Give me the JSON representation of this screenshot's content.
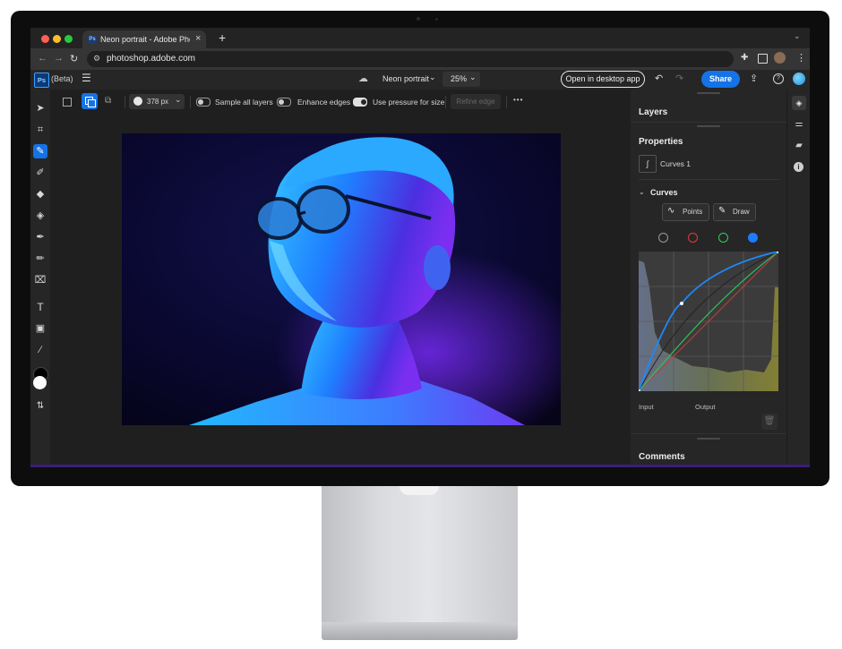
{
  "browser": {
    "tab_title": "Neon portrait - Adobe Photosh",
    "tab_close": "×",
    "new_tab": "+",
    "url": "photoshop.adobe.com",
    "tab_icon_text": "Ps"
  },
  "app": {
    "logo": "Ps",
    "beta_label": "(Beta)",
    "document_name": "Neon portrait",
    "zoom": "25%",
    "open_desktop_label": "Open in desktop app",
    "share_label": "Share"
  },
  "options_bar": {
    "brush_size": "378 px",
    "sample_all_layers": "Sample all layers",
    "enhance_edges": "Enhance edges",
    "use_pressure": "Use pressure for size",
    "refine_edge": "Refine edge",
    "more": "•••",
    "sample_all_layers_on": false,
    "enhance_edges_on": false,
    "use_pressure_on": true
  },
  "panels": {
    "layers_title": "Layers",
    "properties_title": "Properties",
    "adjustment_name": "Curves 1",
    "curves_title": "Curves",
    "points_label": "Points",
    "draw_label": "Draw",
    "input_label": "Input",
    "output_label": "Output",
    "comments_title": "Comments",
    "selected_channel": "blue"
  },
  "colors": {
    "accent": "#1473e6",
    "canvas_bg": "#1f1f1f",
    "panel_bg": "#262626"
  },
  "canvas": {
    "image_description": "neon portrait"
  }
}
